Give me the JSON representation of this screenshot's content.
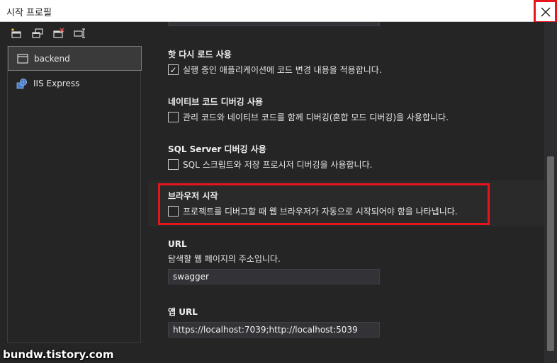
{
  "window": {
    "title": "시작 프로필",
    "close_icon": "close-icon"
  },
  "toolbar": {
    "icons": [
      "new-profile-icon",
      "copy-profile-icon",
      "delete-profile-icon",
      "rename-profile-icon"
    ]
  },
  "profiles": [
    {
      "label": "backend",
      "icon": "window-icon",
      "selected": true
    },
    {
      "label": "IIS Express",
      "icon": "iis-globe-icon",
      "selected": false
    }
  ],
  "settings": {
    "hot_reload": {
      "title": "핫 다시 로드 사용",
      "label": "실행 중인 애플리케이션에 코드 변경 내용을 적용합니다.",
      "checked": true
    },
    "native_debug": {
      "title": "네이티브 코드 디버깅 사용",
      "label": "관리 코드와 네이티브 코드를 함께 디버깅(혼합 모드 디버깅)을 사용합니다.",
      "checked": false
    },
    "sql_debug": {
      "title": "SQL Server 디버깅 사용",
      "label": "SQL 스크립트와 저장 프로시저 디버깅을 사용합니다.",
      "checked": false
    },
    "launch_browser": {
      "title": "브라우저 시작",
      "label": "프로젝트를 디버그할 때 웹 브라우저가 자동으로 시작되어야 함을 나타냅니다.",
      "checked": false
    },
    "url": {
      "title": "URL",
      "description": "탐색할 웹 페이지의 주소입니다.",
      "value": "swagger"
    },
    "app_url": {
      "title": "앱 URL",
      "value": "https://localhost:7039;http://localhost:5039"
    }
  },
  "colors": {
    "highlight": "#e8141c",
    "background": "#252526"
  },
  "watermark": "bundw.tistory.com"
}
